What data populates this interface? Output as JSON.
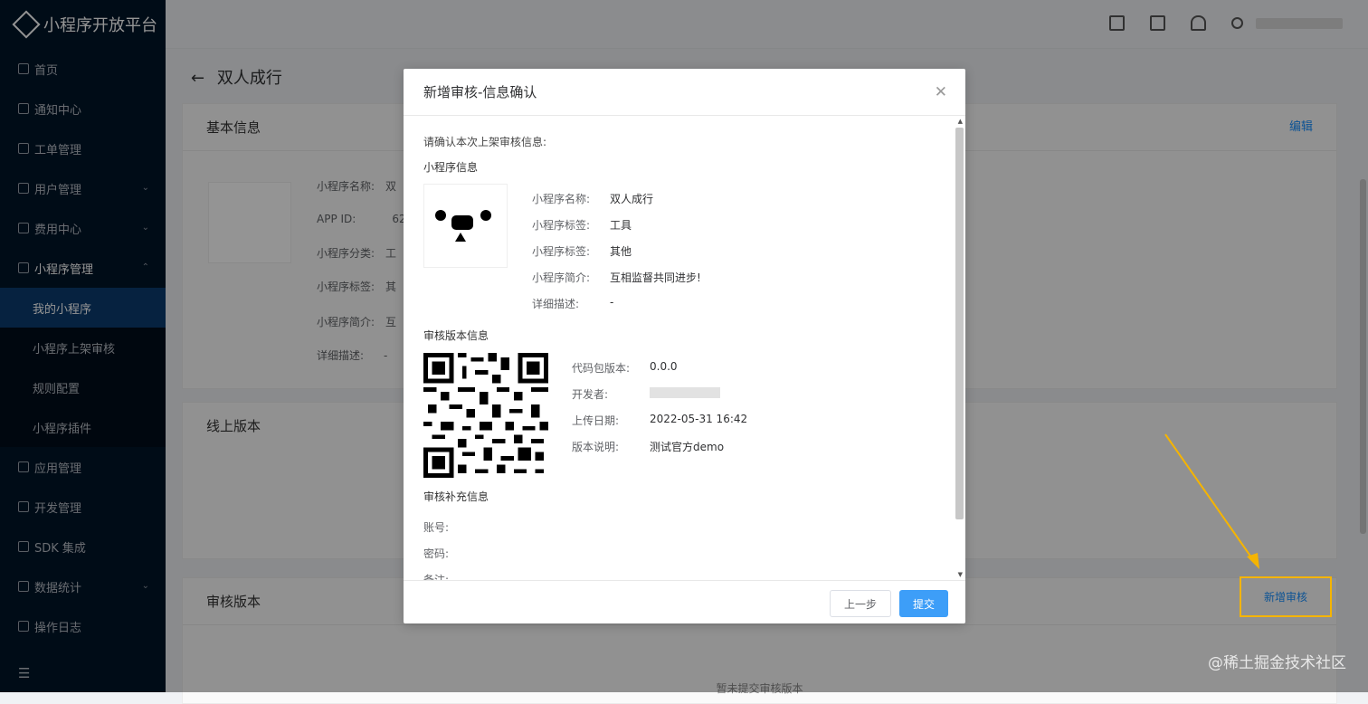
{
  "app": {
    "title": "小程序开放平台"
  },
  "sidebar": {
    "items": [
      {
        "label": "首页"
      },
      {
        "label": "通知中心"
      },
      {
        "label": "工单管理"
      },
      {
        "label": "用户管理"
      },
      {
        "label": "费用中心"
      },
      {
        "label": "小程序管理"
      },
      {
        "label": "应用管理"
      },
      {
        "label": "开发管理"
      },
      {
        "label": "SDK 集成"
      },
      {
        "label": "数据统计"
      },
      {
        "label": "操作日志"
      }
    ],
    "sub_items": [
      {
        "label": "我的小程序"
      },
      {
        "label": "小程序上架审核"
      },
      {
        "label": "规则配置"
      },
      {
        "label": "小程序插件"
      }
    ]
  },
  "page": {
    "title": "双人成行",
    "basic_info": {
      "title": "基本信息",
      "edit": "编辑",
      "rows": [
        {
          "label": "小程序名称:",
          "value": "双"
        },
        {
          "label": "APP ID:",
          "value": "62"
        },
        {
          "label": "小程序分类:",
          "value": "工"
        },
        {
          "label": "小程序标签:",
          "value": "其"
        },
        {
          "label": "小程序简介:",
          "value": "互"
        },
        {
          "label": "详细描述:",
          "value": "-"
        }
      ]
    },
    "online_version": {
      "title": "线上版本"
    },
    "audit_version": {
      "title": "审核版本",
      "empty": "暂未提交审核版本",
      "new_button": "新增审核"
    }
  },
  "modal": {
    "title": "新增审核-信息确认",
    "intro": "请确认本次上架审核信息:",
    "app_info": {
      "title": "小程序信息",
      "rows": [
        {
          "label": "小程序名称:",
          "value": "双人成行"
        },
        {
          "label": "小程序标签:",
          "value": "工具"
        },
        {
          "label": "小程序标签:",
          "value": "其他"
        },
        {
          "label": "小程序简介:",
          "value": "互相监督共同进步!"
        },
        {
          "label": "详细描述:",
          "value": "-"
        }
      ]
    },
    "version_info": {
      "title": "审核版本信息",
      "rows": [
        {
          "label": "代码包版本:",
          "value": "0.0.0"
        },
        {
          "label": "开发者:",
          "value": ""
        },
        {
          "label": "上传日期:",
          "value": "2022-05-31 16:42"
        },
        {
          "label": "版本说明:",
          "value": "测试官方demo"
        }
      ]
    },
    "extra_info": {
      "title": "审核补充信息",
      "rows": [
        {
          "label": "账号:"
        },
        {
          "label": "密码:"
        },
        {
          "label": "备注:"
        }
      ]
    },
    "buttons": {
      "prev": "上一步",
      "submit": "提交"
    }
  },
  "watermark": "@稀土掘金技术社区",
  "colors": {
    "accent": "#1890ff",
    "sidebar_bg": "#001529",
    "highlight": "#f5b400",
    "submit": "#3d9ef8"
  }
}
